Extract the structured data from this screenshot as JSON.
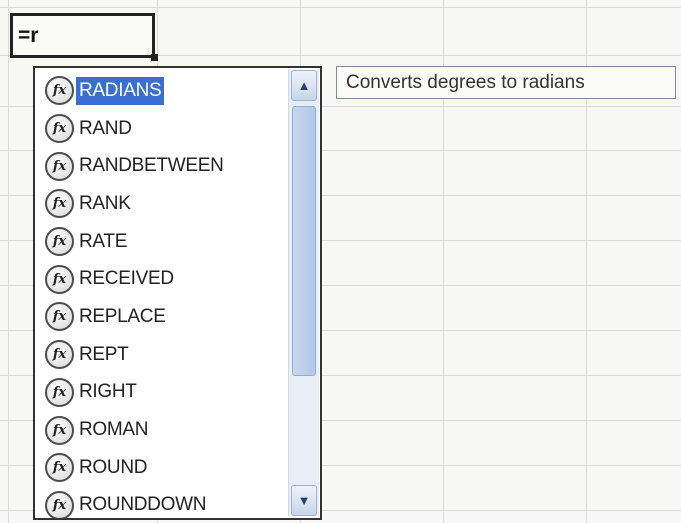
{
  "cell": {
    "formula": "=r"
  },
  "autocomplete": {
    "items": [
      {
        "label": "RADIANS",
        "selected": true
      },
      {
        "label": "RAND",
        "selected": false
      },
      {
        "label": "RANDBETWEEN",
        "selected": false
      },
      {
        "label": "RANK",
        "selected": false
      },
      {
        "label": "RATE",
        "selected": false
      },
      {
        "label": "RECEIVED",
        "selected": false
      },
      {
        "label": "REPLACE",
        "selected": false
      },
      {
        "label": "REPT",
        "selected": false
      },
      {
        "label": "RIGHT",
        "selected": false
      },
      {
        "label": "ROMAN",
        "selected": false
      },
      {
        "label": "ROUND",
        "selected": false
      },
      {
        "label": "ROUNDDOWN",
        "selected": false
      }
    ],
    "item_icon": "function-fx-icon",
    "icon_glyph": "fx"
  },
  "tooltip": {
    "text": "Converts degrees to radians"
  },
  "colors": {
    "selection": "#3a6fd1",
    "grid": "#d9dcd6",
    "scrollbar": "#b2c8e6"
  }
}
